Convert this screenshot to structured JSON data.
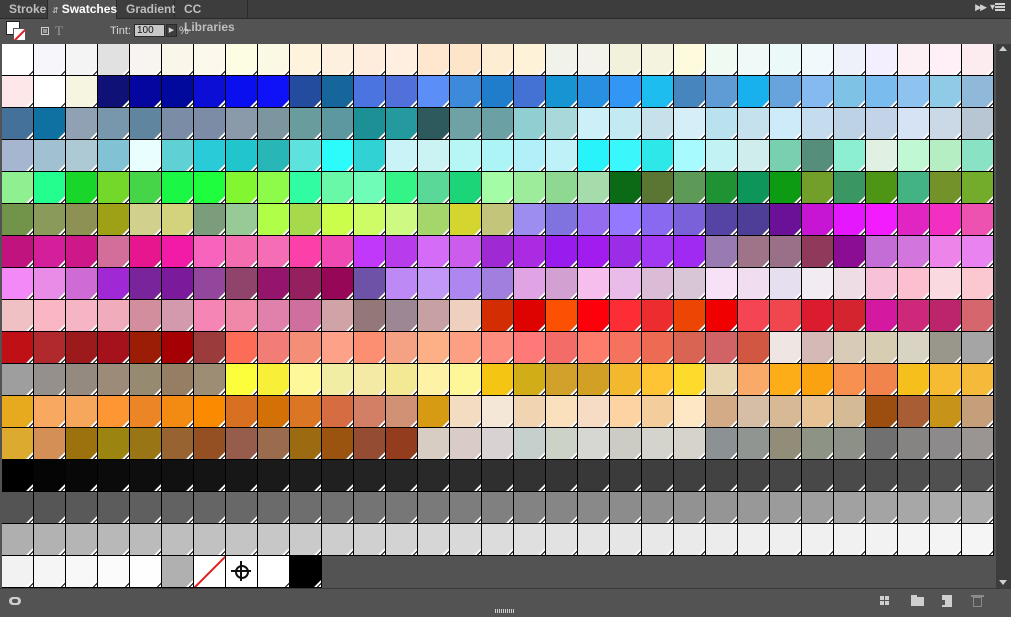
{
  "tabs": [
    {
      "label": "Stroke",
      "active": false
    },
    {
      "label": "Swatches",
      "active": true
    },
    {
      "label": "Gradient",
      "active": false
    },
    {
      "label": "CC Libraries",
      "active": false
    }
  ],
  "controls": {
    "tint_label": "Tint:",
    "tint_value": "100",
    "tint_unit": "%",
    "text_format_glyph": "T"
  },
  "icons": {
    "collapse": "collapse-panel-icon",
    "menu": "panel-menu-icon",
    "library": "cc-library-icon",
    "kind": "show-swatch-kinds-icon",
    "folder": "new-color-group-icon",
    "new": "new-swatch-icon",
    "trash": "delete-swatch-icon"
  },
  "swatches": [
    [
      "#ffffff",
      "#f7f7fb",
      "#f4f4f4",
      "#e1e1e1",
      "#f8f5f0",
      "#fbf6ea",
      "#fdf8ec",
      "#fdfde4",
      "#fbf8e3",
      "#fef3dc",
      "#fef0de",
      "#feeddc",
      "#feefe0",
      "#ffe6cf",
      "#fde5ca",
      "#fdedd2",
      "#fef2d9",
      "#f1f2ea",
      "#f3f3ec",
      "#f1f1dc",
      "#f3f3e0",
      "#fdfadd",
      "#effaf3",
      "#eef9f8",
      "#ebfaf8",
      "#f0f9fb",
      "#eef1f9",
      "#f3efff",
      "#fdf0f5",
      "#fef0f6",
      "#fcecef"
    ],
    [
      "#fde7e8",
      "#ffffff",
      "#f5f5e1",
      "#101177",
      "#04069f",
      "#00099c",
      "#0c0ed6",
      "#0a0ff0",
      "#0f12f6",
      "#234b9e",
      "#16669c",
      "#4b74e0",
      "#5170d9",
      "#5b8ef7",
      "#3d89da",
      "#1f7dcc",
      "#4471d4",
      "#1795d3",
      "#2890e0",
      "#3297f4",
      "#1dbdf0",
      "#4785be",
      "#5f9bd5",
      "#18b1ee",
      "#67a3dd",
      "#84baef",
      "#7ec2e5",
      "#7abced",
      "#8dc3ee",
      "#8fcbe6",
      "#90b8d8"
    ],
    [
      "#437199",
      "#0f71a1",
      "#8fa1b3",
      "#7897ac",
      "#60859f",
      "#7b8ca6",
      "#7c8ba6",
      "#8a9aab",
      "#7c96a0",
      "#699c9d",
      "#5d98a1",
      "#1c9095",
      "#259a9e",
      "#2e5a5e",
      "#6ea2a4",
      "#6ba0a4",
      "#8fcfd2",
      "#a9d8db",
      "#cdeff8",
      "#c3e9f2",
      "#c7e1ea",
      "#d5eef7",
      "#b9e1ee",
      "#c5e1ed",
      "#cdebf8",
      "#c5dcef",
      "#bdd2e5",
      "#c3d3e8",
      "#d5e3f5",
      "#cbd9e7",
      "#b8c6d4"
    ],
    [
      "#a7b6d0",
      "#a1c0d2",
      "#acc9d4",
      "#81c3d4",
      "#e9fefe",
      "#5fd0d3",
      "#2acbd8",
      "#20c6cc",
      "#29b6b6",
      "#5ee2de",
      "#2bfbfa",
      "#31d2d3",
      "#caf3f8",
      "#cbf3f3",
      "#b6f6f4",
      "#adf4f6",
      "#b1f0f8",
      "#bff1f8",
      "#29f3fa",
      "#39f7fa",
      "#2ee7e9",
      "#a7fafd",
      "#c2f2f3",
      "#cfeded",
      "#79d0b0",
      "#568e7c",
      "#8cefd2",
      "#e0f0e2",
      "#bff8d3",
      "#b6eec4",
      "#8ae2c4"
    ],
    [
      "#8ff092",
      "#24fe8e",
      "#18d62a",
      "#73d82a",
      "#46d549",
      "#1af745",
      "#1ffe3e",
      "#82f631",
      "#8dfb49",
      "#30fda2",
      "#69f7a8",
      "#6ffcb7",
      "#35f487",
      "#59d898",
      "#1bd578",
      "#a5fca6",
      "#9cec9c",
      "#8fd892",
      "#a6dcab",
      "#0b6a16",
      "#5b7532",
      "#5d9a58",
      "#1f9333",
      "#0e9559",
      "#0d9b13",
      "#719f2a",
      "#3a9763",
      "#4e9515",
      "#44b383",
      "#73922a",
      "#72ac2a"
    ],
    [
      "#72944a",
      "#8a9a5b",
      "#8d9154",
      "#9ea015",
      "#d1d08d",
      "#d2d37c",
      "#7c9d7b",
      "#97ca96",
      "#b0fe48",
      "#a7d94c",
      "#cafe4a",
      "#cdfc66",
      "#cefa83",
      "#a5d66b",
      "#d4d52e",
      "#c3c57b",
      "#9d8df0",
      "#8173df",
      "#946cef",
      "#9478ff",
      "#8a69f1",
      "#7a61d9",
      "#5544a4",
      "#4e3e98",
      "#6b1198",
      "#c716d3",
      "#e517fc",
      "#f31cfe",
      "#e125c3",
      "#f22fc1",
      "#ed52b1"
    ],
    [
      "#c0137d",
      "#d51f9a",
      "#ce1789",
      "#d36e9b",
      "#e7168e",
      "#f21ba8",
      "#f763bd",
      "#f36db0",
      "#f56db5",
      "#fb41a9",
      "#f049b2",
      "#c138fa",
      "#b83cec",
      "#d56cf7",
      "#cc5ceb",
      "#9f2ad3",
      "#ab2be2",
      "#9a1bed",
      "#a21cef",
      "#9c2de6",
      "#a239f2",
      "#a12af3",
      "#9a7bb1",
      "#a07488",
      "#9a7088",
      "#8f3a5b",
      "#8b0d94",
      "#c56dd6",
      "#d275dc",
      "#ec84ea",
      "#e883f0"
    ],
    [
      "#f389f7",
      "#e98ce8",
      "#ce6bd4",
      "#a028d5",
      "#79249a",
      "#7b1a9a",
      "#92479c",
      "#90436b",
      "#94156b",
      "#952060",
      "#960757",
      "#6e52a7",
      "#bc89f5",
      "#c298f7",
      "#ad86f0",
      "#a17fde",
      "#e0a3e3",
      "#d3a0d2",
      "#f5beed",
      "#e8bbe9",
      "#dbbcd7",
      "#d8c5d6",
      "#f6e1f7",
      "#f0ddf0",
      "#e6dff0",
      "#f3ebf2",
      "#eedde5",
      "#f7c2d8",
      "#fbbfd0",
      "#fad9e0",
      "#fbc8cf"
    ],
    [
      "#f0c1c4",
      "#fbb6c4",
      "#f6b5c5",
      "#f1acbb",
      "#d38e9d",
      "#d39aad",
      "#f585b4",
      "#f088aa",
      "#df81aa",
      "#cf6f9d",
      "#d0a3a7",
      "#947779",
      "#9e8795",
      "#c6a0a3",
      "#efcfbd",
      "#d32e03",
      "#de0200",
      "#fc5102",
      "#fe000b",
      "#fd2d35",
      "#ed2c2f",
      "#ed4604",
      "#f00000",
      "#f54552",
      "#f0464e",
      "#da1c2e",
      "#d4242f",
      "#d418a0",
      "#cd2879",
      "#bc246c",
      "#d5666e"
    ],
    [
      "#bf1115",
      "#b02a2d",
      "#9d1a1c",
      "#a5121c",
      "#9b1d06",
      "#a50104",
      "#9b3b3b",
      "#fd6c56",
      "#f27d77",
      "#f58e76",
      "#fda289",
      "#fc8e72",
      "#f4a184",
      "#fdaf86",
      "#fc9f83",
      "#fd8d7f",
      "#fe7977",
      "#f46c68",
      "#fe7c6c",
      "#f5735e",
      "#ed6b53",
      "#d96453",
      "#d16366",
      "#d25743",
      "#efe5e2",
      "#d4b9b6",
      "#d8cbb8",
      "#d7cdb3",
      "#d9d3c3",
      "#99978b",
      "#a5a5a5"
    ],
    [
      "#9e9e9e",
      "#95908c",
      "#958a7f",
      "#9c8b79",
      "#968b70",
      "#957e63",
      "#9d8d74",
      "#fcfd3b",
      "#f7ef38",
      "#fef899",
      "#f1eda5",
      "#f5eaa5",
      "#f3e894",
      "#fdf2a6",
      "#fef79a",
      "#f4c512",
      "#d1ae17",
      "#d2a12c",
      "#d1a025",
      "#f3b92e",
      "#fec433",
      "#fddb2d",
      "#e7d6b0",
      "#f9aa69",
      "#fcad17",
      "#fba211",
      "#f89050",
      "#f0844c",
      "#f6c01c",
      "#f6ba33",
      "#f6ba3a"
    ],
    [
      "#e7a91e",
      "#f9a85f",
      "#f6a75b",
      "#fe9633",
      "#ec8525",
      "#f38b12",
      "#fa8b00",
      "#d87022",
      "#d47106",
      "#db7625",
      "#d66d42",
      "#d37f66",
      "#d09175",
      "#d69b13",
      "#f3dcc1",
      "#f4e7d8",
      "#f1d4b1",
      "#fae0bd",
      "#f6dcc4",
      "#fdd3a3",
      "#f3cd9c",
      "#fde7c5",
      "#d3ab87",
      "#d6bda5",
      "#d8b995",
      "#e7c294",
      "#d4ba95",
      "#9b4e10",
      "#a95d34",
      "#c89319",
      "#c49f79"
    ],
    [
      "#ddaa30",
      "#d48f57",
      "#9b720e",
      "#9c8411",
      "#997515",
      "#976331",
      "#945023",
      "#975d4c",
      "#9b6b4d",
      "#9b6a11",
      "#9b5410",
      "#944c32",
      "#943d1e",
      "#d8cdc3",
      "#d9ccc6",
      "#d8d2d2",
      "#c5d0cd",
      "#cdd2c7",
      "#d6d6d3",
      "#cccbc4",
      "#d4d4cd",
      "#d6d3cb",
      "#8c9293",
      "#909591",
      "#918d79",
      "#8e9485",
      "#8d9086",
      "#707070",
      "#868383",
      "#8d8a8b",
      "#9a9592"
    ],
    [
      "#000000",
      "#050505",
      "#080808",
      "#0b0b0b",
      "#0e0e0e",
      "#111111",
      "#141414",
      "#171717",
      "#1a1a1a",
      "#1d1d1d",
      "#202020",
      "#232323",
      "#262626",
      "#292929",
      "#2c2c2c",
      "#2f2f2f",
      "#323232",
      "#353535",
      "#383838",
      "#3b3b3b",
      "#3e3e3e",
      "#404040",
      "#424242",
      "#444444",
      "#464646",
      "#484848",
      "#4a4a4a",
      "#4c4c4c",
      "#4e4e4e",
      "#505050",
      "#525252"
    ],
    [
      "#545454",
      "#565656",
      "#595959",
      "#5c5c5c",
      "#5f5f5f",
      "#626262",
      "#656565",
      "#686868",
      "#6b6b6b",
      "#6e6e6e",
      "#717171",
      "#747474",
      "#777777",
      "#7a7a7a",
      "#7d7d7d",
      "#808080",
      "#838383",
      "#868686",
      "#898989",
      "#8c8c8c",
      "#8f8f8f",
      "#929292",
      "#959595",
      "#989898",
      "#9b9b9b",
      "#9e9e9e",
      "#a1a1a1",
      "#a4a4a4",
      "#a7a7a7",
      "#aaaaaa",
      "#adadad"
    ],
    [
      "#afafaf",
      "#b2b2b2",
      "#b5b5b5",
      "#b8b8b8",
      "#bbbbbb",
      "#bebebe",
      "#c1c1c1",
      "#c4c4c4",
      "#c7c7c7",
      "#cacaca",
      "#cdcdcd",
      "#d0d0d0",
      "#d3d3d3",
      "#d6d6d6",
      "#d9d9d9",
      "#dcdcdc",
      "#dfdfdf",
      "#e2e2e2",
      "#e4e4e4",
      "#e6e6e6",
      "#e8e8e8",
      "#eaeaea",
      "#ececec",
      "#eeeeee",
      "#efefef",
      "#f0f0f0",
      "#f1f1f1",
      "#f2f2f2",
      "#f3f3f3",
      "#f4f4f4",
      "#f5f5f5"
    ],
    [
      "#f2f2f2",
      "#f5f5f5",
      "#f8f8f8",
      "#fbfbfb",
      "#fefefe",
      "#b0b0b0",
      "none",
      "registration",
      "#ffffff",
      "#000000"
    ]
  ]
}
